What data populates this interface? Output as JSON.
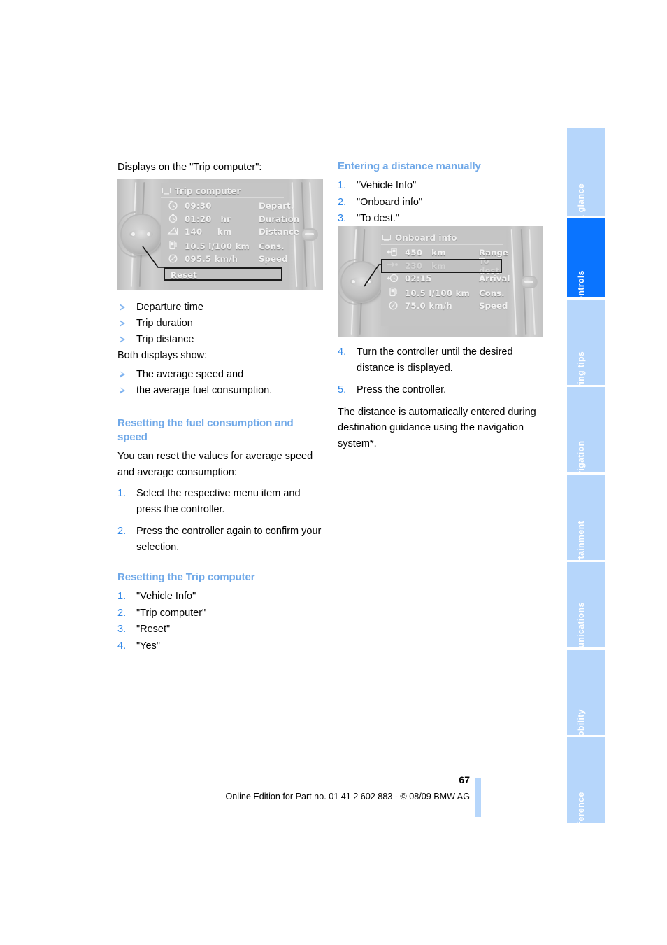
{
  "left_column": {
    "intro": "Displays on the \"Trip computer\":",
    "figure_trip_computer": {
      "title": "Trip computer",
      "title_icon": "display-screen-icon",
      "rows": [
        {
          "icon": "departure-clock-icon",
          "value": "09:30",
          "unit": "",
          "label": "Depart."
        },
        {
          "icon": "stopwatch-icon",
          "value": "01:20",
          "unit": "hr",
          "label": "Duration"
        },
        {
          "icon": "trip-distance-icon",
          "value": "140",
          "unit": "km",
          "label": "Distance"
        },
        {
          "icon": "fuel-pump-icon",
          "value": "10.5 l/100 km",
          "unit": "",
          "label": "Cons."
        },
        {
          "icon": "speedometer-icon",
          "value": "095.5 km/h",
          "unit": "",
          "label": "Speed"
        }
      ],
      "reset_button": "Reset"
    },
    "bullets_first": [
      "Departure time",
      "Trip duration",
      "Trip distance"
    ],
    "both_displays_text": "Both displays show:",
    "bullets_second": [
      "The average speed and",
      "the average fuel consumption."
    ],
    "heading_reset_fuel": "Resetting the fuel consumption and speed",
    "reset_fuel_intro": "You can reset the values for average speed and average consumption:",
    "reset_fuel_steps": [
      {
        "num": "1.",
        "text": "Select the respective menu item and press the controller."
      },
      {
        "num": "2.",
        "text": "Press the controller again to confirm your selection."
      }
    ],
    "heading_reset_trip": "Resetting the Trip computer",
    "reset_trip_steps": [
      {
        "num": "1.",
        "text": "\"Vehicle Info\""
      },
      {
        "num": "2.",
        "text": "\"Trip computer\""
      },
      {
        "num": "3.",
        "text": "\"Reset\""
      },
      {
        "num": "4.",
        "text": "\"Yes\""
      }
    ]
  },
  "right_column": {
    "heading_entering_distance": "Entering a distance manually",
    "steps_before_figure": [
      {
        "num": "1.",
        "text": "\"Vehicle Info\""
      },
      {
        "num": "2.",
        "text": "\"Onboard info\""
      },
      {
        "num": "3.",
        "text": "\"To dest.\""
      }
    ],
    "figure_onboard_info": {
      "title": "Onboard info",
      "title_icon": "display-screen-icon",
      "rows": [
        {
          "icon": "fuel-range-icon",
          "value": "450",
          "unit": "km",
          "label": "Range",
          "selected": false
        },
        {
          "icon": "to-destination-arrow-icon",
          "value": "230",
          "unit": "km",
          "label": "To dest.",
          "selected": true
        },
        {
          "icon": "arrival-clock-icon",
          "value": "02:15",
          "unit": "",
          "label": "Arrival",
          "selected": false
        },
        {
          "icon": "fuel-pump-icon",
          "value": "10.5 l/100 km",
          "unit": "",
          "label": "Cons.",
          "selected": false
        },
        {
          "icon": "speedometer-icon",
          "value": "75.0 km/h",
          "unit": "",
          "label": "Speed",
          "selected": false
        }
      ]
    },
    "steps_after_figure": [
      {
        "num": "4.",
        "text": "Turn the controller until the desired distance is displayed."
      },
      {
        "num": "5.",
        "text": "Press the controller."
      }
    ],
    "closing_paragraph": "The distance is automatically entered during destination guidance using the navigation system*."
  },
  "sidebar": {
    "tabs": [
      {
        "label": "At a glance",
        "active": false
      },
      {
        "label": "Controls",
        "active": true
      },
      {
        "label": "Driving tips",
        "active": false
      },
      {
        "label": "Navigation",
        "active": false
      },
      {
        "label": "Entertainment",
        "active": false
      },
      {
        "label": "Communications",
        "active": false
      },
      {
        "label": "Mobility",
        "active": false
      },
      {
        "label": "Reference",
        "active": false
      }
    ]
  },
  "footer": {
    "page_number": "67",
    "imprint": "Online Edition for Part no. 01 41 2 602 883 - © 08/09 BMW AG"
  },
  "colors": {
    "heading_blue": "#6fa8e8",
    "number_blue": "#2e86e8",
    "tab_inactive": "#b6d6fb",
    "tab_active": "#0a74ff"
  }
}
